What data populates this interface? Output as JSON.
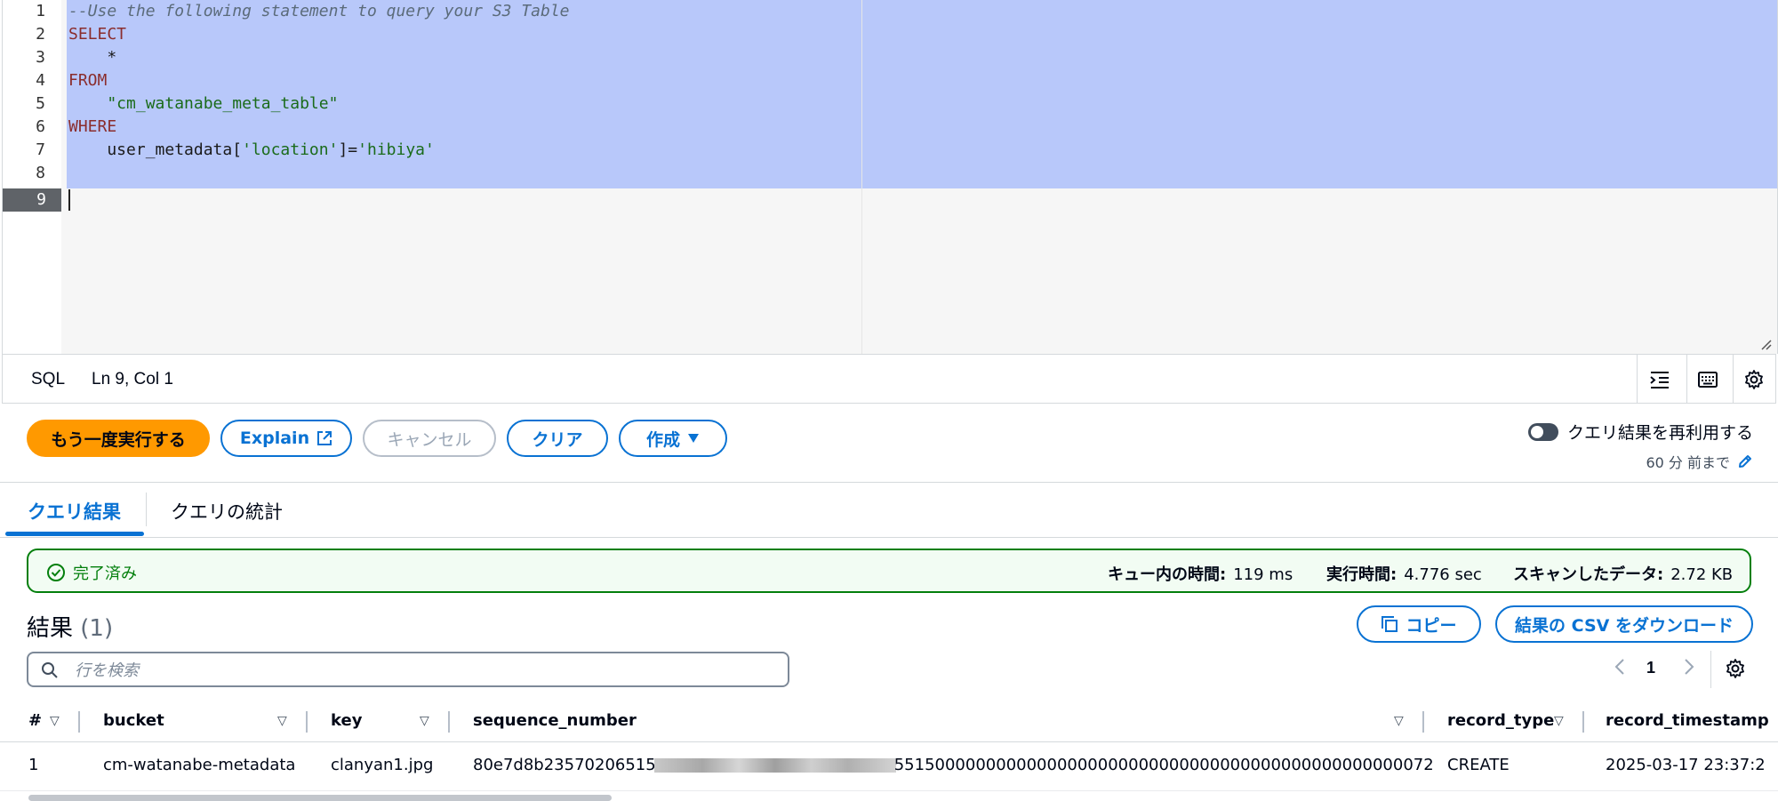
{
  "editor": {
    "lines": [
      {
        "num": "1",
        "comment": "--Use the following statement to query your S3 Table"
      },
      {
        "num": "2",
        "keyword": "SELECT"
      },
      {
        "num": "3",
        "text": "    *"
      },
      {
        "num": "4",
        "keyword": "FROM"
      },
      {
        "num": "5",
        "string": "    \"cm_watanabe_meta_table\""
      },
      {
        "num": "6",
        "keyword": "WHERE"
      },
      {
        "num": "7",
        "text": "    user_metadata[",
        "string1": "'location'",
        "text2": "]=",
        "string2": "'hibiya'"
      },
      {
        "num": "8",
        "text": ""
      },
      {
        "num": "9",
        "text": ""
      }
    ]
  },
  "statusbar": {
    "language": "SQL",
    "position": "Ln 9, Col 1",
    "icons": [
      "indent-icon",
      "keyboard-icon",
      "gear-icon"
    ]
  },
  "actions": {
    "rerun_label": "もう一度実行する",
    "explain_label": "Explain",
    "cancel_label": "キャンセル",
    "clear_label": "クリア",
    "create_label": "作成",
    "reuse_toggle_label": "クエリ結果を再利用する",
    "reuse_subtext": "60 分 前まで"
  },
  "tabs": [
    {
      "label": "クエリ結果",
      "active": true
    },
    {
      "label": "クエリの統計",
      "active": false
    }
  ],
  "banner": {
    "status": "完了済み",
    "queue_label": "キュー内の時間:",
    "queue_value": "119 ms",
    "exec_label": "実行時間:",
    "exec_value": "4.776 sec",
    "scan_label": "スキャンしたデータ:",
    "scan_value": "2.72 KB",
    "color": "#037f0c"
  },
  "results": {
    "title": "結果",
    "count": "(1)",
    "copy_label": "コピー",
    "download_label": "結果の CSV をダウンロード",
    "search_placeholder": "行を検索",
    "page": "1"
  },
  "table": {
    "columns": [
      "#",
      "bucket",
      "key",
      "sequence_number",
      "record_type",
      "record_timestamp"
    ],
    "rows": [
      {
        "index": "1",
        "bucket": "cm-watanabe-metadata",
        "key": "clanyan1.jpg",
        "seq_prefix": "80e7d8b23570206515",
        "seq_suffix": "55150000000000000000000000000000000000000000000000072",
        "record_type": "CREATE",
        "record_timestamp": "2025-03-17 23:37:2"
      }
    ]
  }
}
